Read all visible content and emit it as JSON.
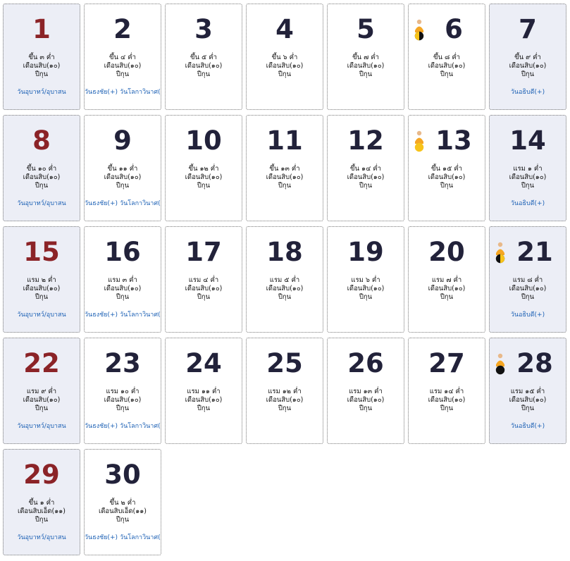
{
  "days": [
    {
      "day": "1",
      "lunar": "ขึ้น ๓ ค่ำ",
      "month": "เดือนสิบ(๑๐)",
      "year": "ปีกุน",
      "links": [
        "วันอุบาทว์/อุบาสน"
      ],
      "sunday": true,
      "weekend": true,
      "icon": ""
    },
    {
      "day": "2",
      "lunar": "ขึ้น ๔ ค่ำ",
      "month": "เดือนสิบ(๑๐)",
      "year": "ปีกุน",
      "links": [
        "วันธงชัย(+)",
        "วันโลกาวินาศ(-)"
      ],
      "sunday": false,
      "weekend": false,
      "icon": ""
    },
    {
      "day": "3",
      "lunar": "ขึ้น ๕ ค่ำ",
      "month": "เดือนสิบ(๑๐)",
      "year": "ปีกุน",
      "links": [],
      "sunday": false,
      "weekend": false,
      "icon": ""
    },
    {
      "day": "4",
      "lunar": "ขึ้น ๖ ค่ำ",
      "month": "เดือนสิบ(๑๐)",
      "year": "ปีกุน",
      "links": [],
      "sunday": false,
      "weekend": false,
      "icon": ""
    },
    {
      "day": "5",
      "lunar": "ขึ้น ๗ ค่ำ",
      "month": "เดือนสิบ(๑๐)",
      "year": "ปีกุน",
      "links": [],
      "sunday": false,
      "weekend": false,
      "icon": ""
    },
    {
      "day": "6",
      "lunar": "ขึ้น ๘ ค่ำ",
      "month": "เดือนสิบ(๑๐)",
      "year": "ปีกุน",
      "links": [],
      "sunday": false,
      "weekend": false,
      "icon": "monk-first-quarter-moon-icon"
    },
    {
      "day": "7",
      "lunar": "ขึ้น ๙ ค่ำ",
      "month": "เดือนสิบ(๑๐)",
      "year": "ปีกุน",
      "links": [
        "วันอธิบดี(+)"
      ],
      "sunday": false,
      "weekend": true,
      "icon": ""
    },
    {
      "day": "8",
      "lunar": "ขึ้น ๑๐ ค่ำ",
      "month": "เดือนสิบ(๑๐)",
      "year": "ปีกุน",
      "links": [
        "วันอุบาทว์/อุบาสน"
      ],
      "sunday": true,
      "weekend": true,
      "icon": ""
    },
    {
      "day": "9",
      "lunar": "ขึ้น ๑๑ ค่ำ",
      "month": "เดือนสิบ(๑๐)",
      "year": "ปีกุน",
      "links": [
        "วันธงชัย(+)",
        "วันโลกาวินาศ(-)"
      ],
      "sunday": false,
      "weekend": false,
      "icon": ""
    },
    {
      "day": "10",
      "lunar": "ขึ้น ๑๒ ค่ำ",
      "month": "เดือนสิบ(๑๐)",
      "year": "ปีกุน",
      "links": [],
      "sunday": false,
      "weekend": false,
      "icon": ""
    },
    {
      "day": "11",
      "lunar": "ขึ้น ๑๓ ค่ำ",
      "month": "เดือนสิบ(๑๐)",
      "year": "ปีกุน",
      "links": [],
      "sunday": false,
      "weekend": false,
      "icon": ""
    },
    {
      "day": "12",
      "lunar": "ขึ้น ๑๔ ค่ำ",
      "month": "เดือนสิบ(๑๐)",
      "year": "ปีกุน",
      "links": [],
      "sunday": false,
      "weekend": false,
      "icon": ""
    },
    {
      "day": "13",
      "lunar": "ขึ้น ๑๕ ค่ำ",
      "month": "เดือนสิบ(๑๐)",
      "year": "ปีกุน",
      "links": [],
      "sunday": false,
      "weekend": false,
      "icon": "monk-full-moon-icon"
    },
    {
      "day": "14",
      "lunar": "แรม ๑ ค่ำ",
      "month": "เดือนสิบ(๑๐)",
      "year": "ปีกุน",
      "links": [
        "วันอธิบดี(+)"
      ],
      "sunday": false,
      "weekend": true,
      "icon": ""
    },
    {
      "day": "15",
      "lunar": "แรม ๒ ค่ำ",
      "month": "เดือนสิบ(๑๐)",
      "year": "ปีกุน",
      "links": [
        "วันอุบาทว์/อุบาสน"
      ],
      "sunday": true,
      "weekend": true,
      "icon": ""
    },
    {
      "day": "16",
      "lunar": "แรม ๓ ค่ำ",
      "month": "เดือนสิบ(๑๐)",
      "year": "ปีกุน",
      "links": [
        "วันธงชัย(+)",
        "วันโลกาวินาศ(-)"
      ],
      "sunday": false,
      "weekend": false,
      "icon": ""
    },
    {
      "day": "17",
      "lunar": "แรม ๔ ค่ำ",
      "month": "เดือนสิบ(๑๐)",
      "year": "ปีกุน",
      "links": [],
      "sunday": false,
      "weekend": false,
      "icon": ""
    },
    {
      "day": "18",
      "lunar": "แรม ๕ ค่ำ",
      "month": "เดือนสิบ(๑๐)",
      "year": "ปีกุน",
      "links": [],
      "sunday": false,
      "weekend": false,
      "icon": ""
    },
    {
      "day": "19",
      "lunar": "แรม ๖ ค่ำ",
      "month": "เดือนสิบ(๑๐)",
      "year": "ปีกุน",
      "links": [],
      "sunday": false,
      "weekend": false,
      "icon": ""
    },
    {
      "day": "20",
      "lunar": "แรม ๗ ค่ำ",
      "month": "เดือนสิบ(๑๐)",
      "year": "ปีกุน",
      "links": [],
      "sunday": false,
      "weekend": false,
      "icon": ""
    },
    {
      "day": "21",
      "lunar": "แรม ๘ ค่ำ",
      "month": "เดือนสิบ(๑๐)",
      "year": "ปีกุน",
      "links": [
        "วันอธิบดี(+)"
      ],
      "sunday": false,
      "weekend": true,
      "icon": "monk-last-quarter-moon-icon"
    },
    {
      "day": "22",
      "lunar": "แรม ๙ ค่ำ",
      "month": "เดือนสิบ(๑๐)",
      "year": "ปีกุน",
      "links": [
        "วันอุบาทว์/อุบาสน"
      ],
      "sunday": true,
      "weekend": true,
      "icon": ""
    },
    {
      "day": "23",
      "lunar": "แรม ๑๐ ค่ำ",
      "month": "เดือนสิบ(๑๐)",
      "year": "ปีกุน",
      "links": [
        "วันธงชัย(+)",
        "วันโลกาวินาศ(-)"
      ],
      "sunday": false,
      "weekend": false,
      "icon": ""
    },
    {
      "day": "24",
      "lunar": "แรม ๑๑ ค่ำ",
      "month": "เดือนสิบ(๑๐)",
      "year": "ปีกุน",
      "links": [],
      "sunday": false,
      "weekend": false,
      "icon": ""
    },
    {
      "day": "25",
      "lunar": "แรม ๑๒ ค่ำ",
      "month": "เดือนสิบ(๑๐)",
      "year": "ปีกุน",
      "links": [],
      "sunday": false,
      "weekend": false,
      "icon": ""
    },
    {
      "day": "26",
      "lunar": "แรม ๑๓ ค่ำ",
      "month": "เดือนสิบ(๑๐)",
      "year": "ปีกุน",
      "links": [],
      "sunday": false,
      "weekend": false,
      "icon": ""
    },
    {
      "day": "27",
      "lunar": "แรม ๑๔ ค่ำ",
      "month": "เดือนสิบ(๑๐)",
      "year": "ปีกุน",
      "links": [],
      "sunday": false,
      "weekend": false,
      "icon": ""
    },
    {
      "day": "28",
      "lunar": "แรม ๑๕ ค่ำ",
      "month": "เดือนสิบ(๑๐)",
      "year": "ปีกุน",
      "links": [
        "วันอธิบดี(+)"
      ],
      "sunday": false,
      "weekend": true,
      "icon": "monk-new-moon-icon"
    },
    {
      "day": "29",
      "lunar": "ขึ้น ๑ ค่ำ",
      "month": "เดือนสิบเอ็ด(๑๑)",
      "year": "ปีกุน",
      "links": [
        "วันอุบาทว์/อุบาสน"
      ],
      "sunday": true,
      "weekend": true,
      "icon": ""
    },
    {
      "day": "30",
      "lunar": "ขึ้น ๒ ค่ำ",
      "month": "เดือนสิบเอ็ด(๑๑)",
      "year": "ปีกุน",
      "links": [
        "วันธงชัย(+)",
        "วันโลกาวินาศ(-)"
      ],
      "sunday": false,
      "weekend": false,
      "icon": ""
    }
  ],
  "colors": {
    "sunday_number": "#8b2327",
    "weekday_number": "#22223a",
    "weekend_background": "#eceef6",
    "link": "#1a5fb4",
    "monk_robe": "#f5a623"
  }
}
